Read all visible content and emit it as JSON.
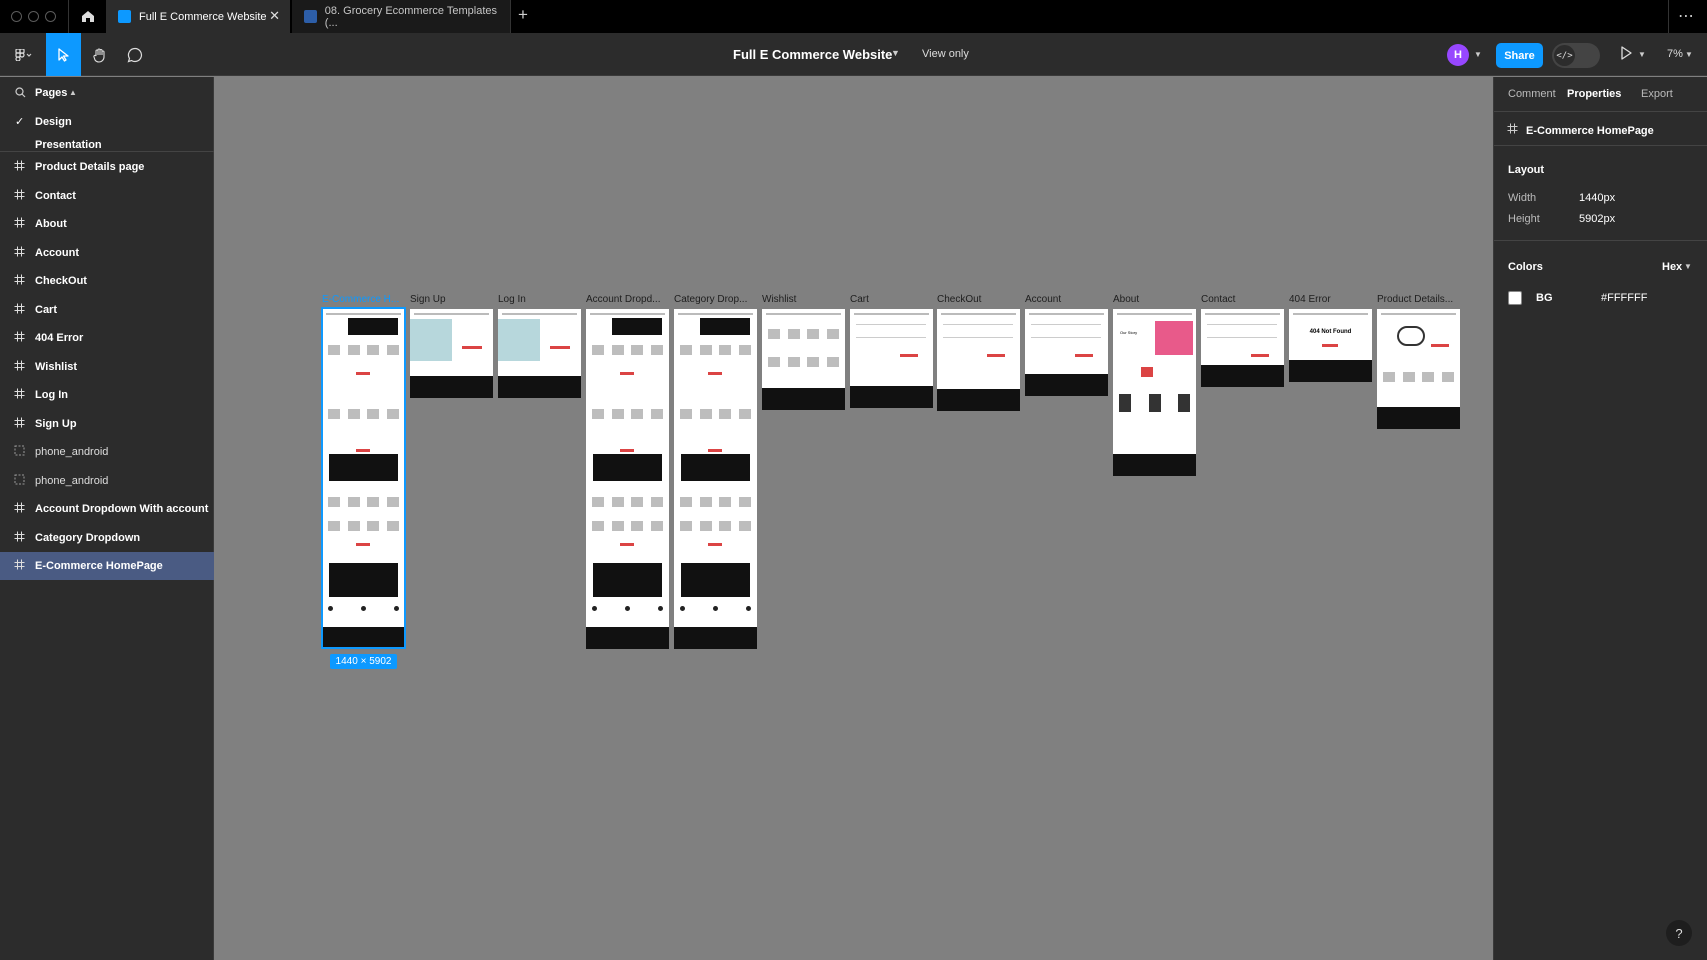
{
  "tabs": [
    {
      "label": "Full E Commerce Website"
    },
    {
      "label": "08. Grocery Ecommerce Templates (..."
    }
  ],
  "toolbar": {
    "file_title": "Full E Commerce Website",
    "view_only": "View only",
    "avatar_initial": "H",
    "share_label": "Share",
    "zoom": "7%"
  },
  "pages": {
    "header": "Pages",
    "items": [
      "Design",
      "Presentation"
    ]
  },
  "layers": [
    "Product Details page",
    "Contact",
    "About",
    "Account",
    "CheckOut",
    "Cart",
    "404 Error",
    "Wishlist",
    "Log In",
    "Sign Up",
    "phone_android",
    "phone_android",
    "Account Dropdown With account",
    "Category Dropdown",
    "E-Commerce HomePage"
  ],
  "canvas": {
    "frames": [
      {
        "label": "E-Commerce H..."
      },
      {
        "label": "Sign Up"
      },
      {
        "label": "Log In"
      },
      {
        "label": "Account Dropd..."
      },
      {
        "label": "Category Drop..."
      },
      {
        "label": "Wishlist"
      },
      {
        "label": "Cart"
      },
      {
        "label": "CheckOut"
      },
      {
        "label": "Account"
      },
      {
        "label": "About"
      },
      {
        "label": "Contact"
      },
      {
        "label": "404 Error"
      },
      {
        "label": "Product Details..."
      }
    ],
    "about_heading": "Our Story",
    "not_found_text": "404 Not Found",
    "size_badge": "1440 × 5902"
  },
  "right_panel": {
    "tabs": [
      "Comment",
      "Properties",
      "Export"
    ],
    "selected_name": "E-Commerce HomePage",
    "layout_title": "Layout",
    "width_label": "Width",
    "width_value": "1440px",
    "height_label": "Height",
    "height_value": "5902px",
    "colors_title": "Colors",
    "hex_label": "Hex",
    "bg_name": "BG",
    "bg_hex": "#FFFFFF"
  },
  "colors": {
    "accent": "#0d99ff",
    "selection": "#4a5b83",
    "canvas": "#808080",
    "panel": "#2c2c2c",
    "frame_red": "#db4444"
  },
  "help_label": "?"
}
